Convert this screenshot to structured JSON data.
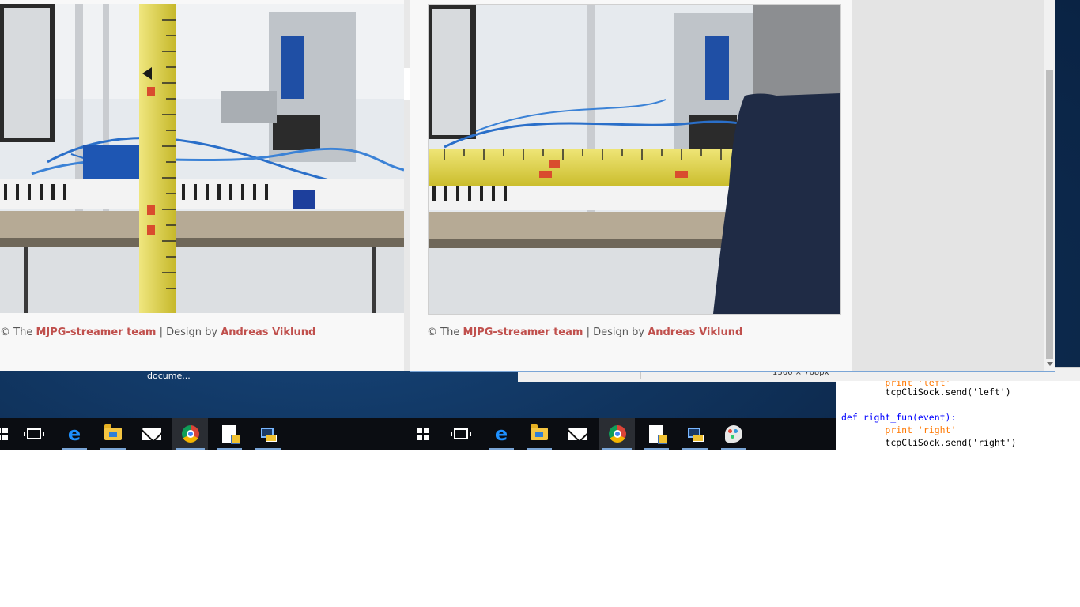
{
  "left_window": {
    "footer": {
      "prefix": "© The ",
      "link1": "MJPG-streamer team",
      "mid": " | Design by ",
      "link2": "Andreas Viklund"
    }
  },
  "right_window": {
    "footer": {
      "prefix": "© The ",
      "link1": "MJPG-streamer team",
      "mid": " | Design by ",
      "link2": "Andreas Viklund"
    }
  },
  "desktop": {
    "label": "docume..."
  },
  "background_app": {
    "status_dims": "1366 × 768px"
  },
  "code_editor": {
    "lines": [
      {
        "indent": "        ",
        "text": "print 'left'"
      },
      {
        "indent": "        ",
        "text": "tcpCliSock.send('left')"
      },
      {
        "indent": "",
        "text": "def right_fun(event):"
      },
      {
        "indent": "        ",
        "text": "print 'right'"
      },
      {
        "indent": "        ",
        "text": "tcpCliSock.send('right')"
      }
    ]
  },
  "taskbar_left": {
    "items": [
      "start-icon",
      "task-view-icon",
      "edge-icon",
      "file-explorer-icon",
      "mail-icon",
      "chrome-icon",
      "python-doc-icon",
      "network-icon"
    ]
  },
  "taskbar_right": {
    "items": [
      "start-icon",
      "task-view-icon",
      "edge-icon",
      "file-explorer-icon",
      "mail-icon",
      "chrome-icon",
      "python-doc-icon",
      "network-icon",
      "paint-icon"
    ]
  },
  "colors": {
    "link": "#c0504d",
    "taskbar": "#0b0d12",
    "active_underline": "#7aa5d6"
  }
}
